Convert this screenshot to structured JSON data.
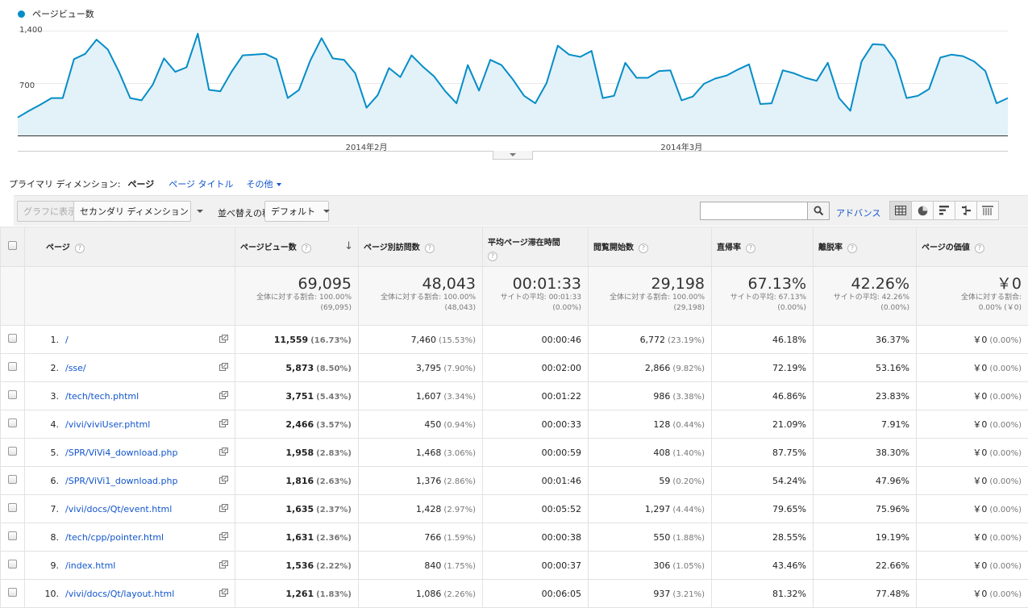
{
  "chart": {
    "legend_label": "ページビュー数",
    "line_color": "#058dc7",
    "fill_color": "#e3f1f8",
    "y_ticks": [
      {
        "label": "1,400",
        "value": 1400
      },
      {
        "label": "700",
        "value": 700
      }
    ],
    "x_labels": [
      {
        "label": "2014年2月",
        "index": 31
      },
      {
        "label": "2014年3月",
        "index": 59
      }
    ]
  },
  "chart_data": {
    "type": "area",
    "series": [
      {
        "name": "ページビュー数",
        "values": [
          240,
          330,
          410,
          500,
          500,
          1020,
          1090,
          1280,
          1150,
          850,
          500,
          470,
          680,
          1030,
          850,
          910,
          1360,
          610,
          590,
          850,
          1070,
          1080,
          1090,
          1020,
          500,
          610,
          1000,
          1300,
          1030,
          1010,
          830,
          370,
          540,
          900,
          780,
          1070,
          920,
          790,
          590,
          430,
          940,
          600,
          1010,
          940,
          750,
          530,
          430,
          700,
          1200,
          1080,
          1050,
          1130,
          500,
          530,
          970,
          770,
          770,
          860,
          870,
          470,
          520,
          690,
          760,
          800,
          880,
          950,
          420,
          430,
          870,
          830,
          770,
          730,
          970,
          500,
          330,
          990,
          1220,
          1210,
          1000,
          500,
          530,
          620,
          1040,
          1080,
          1060,
          990,
          860,
          430,
          500
        ],
        "y_min": 0,
        "y_max": 1400
      }
    ]
  },
  "dimensions": {
    "label": "プライマリ ディメンション:",
    "current": "ページ",
    "alt": "ページ タイトル",
    "more": "その他"
  },
  "toolbar": {
    "graph_btn": "グラフに表示",
    "secondary_btn": "セカンダリ ディメンション",
    "sort_label": "並べ替えの種類:",
    "sort_value": "デフォルト",
    "search_placeholder": "",
    "advanced": "アドバンス"
  },
  "headers": {
    "page": "ページ",
    "pageviews": "ページビュー数",
    "unique": "ページ別訪問数",
    "avg_time": "平均ページ滞在時間",
    "entrances": "閲覧開始数",
    "bounce": "直帰率",
    "exit": "離脱率",
    "value": "ページの価値"
  },
  "totals": {
    "pageviews": {
      "big": "69,095",
      "l1": "全体に対する割合: 100.00%",
      "l2": "(69,095)"
    },
    "unique": {
      "big": "48,043",
      "l1": "全体に対する割合: 100.00%",
      "l2": "(48,043)"
    },
    "avg_time": {
      "big": "00:01:33",
      "l1": "サイトの平均: 00:01:33",
      "l2": "(0.00%)"
    },
    "entrances": {
      "big": "29,198",
      "l1": "全体に対する割合: 100.00%",
      "l2": "(29,198)"
    },
    "bounce": {
      "big": "67.13%",
      "l1": "サイトの平均: 67.13%",
      "l2": "(0.00%)"
    },
    "exit": {
      "big": "42.26%",
      "l1": "サイトの平均: 42.26%",
      "l2": "(0.00%)"
    },
    "value": {
      "big": "￥0",
      "l1": "全体に対する割合:",
      "l2": "0.00% (￥0)"
    }
  },
  "rows": [
    {
      "idx": "1.",
      "url": "/",
      "pv": "11,559",
      "pv_p": "(16.73%)",
      "u": "7,460",
      "u_p": "(15.53%)",
      "t": "00:00:46",
      "e": "6,772",
      "e_p": "(23.19%)",
      "b": "46.18%",
      "x": "36.37%",
      "v": "￥0",
      "v_p": "(0.00%)"
    },
    {
      "idx": "2.",
      "url": "/sse/",
      "pv": "5,873",
      "pv_p": "(8.50%)",
      "u": "3,795",
      "u_p": "(7.90%)",
      "t": "00:02:00",
      "e": "2,866",
      "e_p": "(9.82%)",
      "b": "72.19%",
      "x": "53.16%",
      "v": "￥0",
      "v_p": "(0.00%)"
    },
    {
      "idx": "3.",
      "url": "/tech/tech.phtml",
      "pv": "3,751",
      "pv_p": "(5.43%)",
      "u": "1,607",
      "u_p": "(3.34%)",
      "t": "00:01:22",
      "e": "986",
      "e_p": "(3.38%)",
      "b": "46.86%",
      "x": "23.83%",
      "v": "￥0",
      "v_p": "(0.00%)"
    },
    {
      "idx": "4.",
      "url": "/vivi/viviUser.phtml",
      "pv": "2,466",
      "pv_p": "(3.57%)",
      "u": "450",
      "u_p": "(0.94%)",
      "t": "00:00:33",
      "e": "128",
      "e_p": "(0.44%)",
      "b": "21.09%",
      "x": "7.91%",
      "v": "￥0",
      "v_p": "(0.00%)"
    },
    {
      "idx": "5.",
      "url": "/SPR/ViVi4_download.php",
      "pv": "1,958",
      "pv_p": "(2.83%)",
      "u": "1,468",
      "u_p": "(3.06%)",
      "t": "00:00:59",
      "e": "408",
      "e_p": "(1.40%)",
      "b": "87.75%",
      "x": "38.30%",
      "v": "￥0",
      "v_p": "(0.00%)"
    },
    {
      "idx": "6.",
      "url": "/SPR/ViVi1_download.php",
      "pv": "1,816",
      "pv_p": "(2.63%)",
      "u": "1,376",
      "u_p": "(2.86%)",
      "t": "00:01:46",
      "e": "59",
      "e_p": "(0.20%)",
      "b": "54.24%",
      "x": "47.96%",
      "v": "￥0",
      "v_p": "(0.00%)"
    },
    {
      "idx": "7.",
      "url": "/vivi/docs/Qt/event.html",
      "pv": "1,635",
      "pv_p": "(2.37%)",
      "u": "1,428",
      "u_p": "(2.97%)",
      "t": "00:05:52",
      "e": "1,297",
      "e_p": "(4.44%)",
      "b": "79.65%",
      "x": "75.96%",
      "v": "￥0",
      "v_p": "(0.00%)"
    },
    {
      "idx": "8.",
      "url": "/tech/cpp/pointer.html",
      "pv": "1,631",
      "pv_p": "(2.36%)",
      "u": "766",
      "u_p": "(1.59%)",
      "t": "00:00:38",
      "e": "550",
      "e_p": "(1.88%)",
      "b": "28.55%",
      "x": "19.19%",
      "v": "￥0",
      "v_p": "(0.00%)"
    },
    {
      "idx": "9.",
      "url": "/index.html",
      "pv": "1,536",
      "pv_p": "(2.22%)",
      "u": "840",
      "u_p": "(1.75%)",
      "t": "00:00:37",
      "e": "306",
      "e_p": "(1.05%)",
      "b": "43.46%",
      "x": "22.66%",
      "v": "￥0",
      "v_p": "(0.00%)"
    },
    {
      "idx": "10.",
      "url": "/vivi/docs/Qt/layout.html",
      "pv": "1,261",
      "pv_p": "(1.83%)",
      "u": "1,086",
      "u_p": "(2.26%)",
      "t": "00:06:05",
      "e": "937",
      "e_p": "(3.21%)",
      "b": "81.32%",
      "x": "77.48%",
      "v": "￥0",
      "v_p": "(0.00%)"
    }
  ]
}
